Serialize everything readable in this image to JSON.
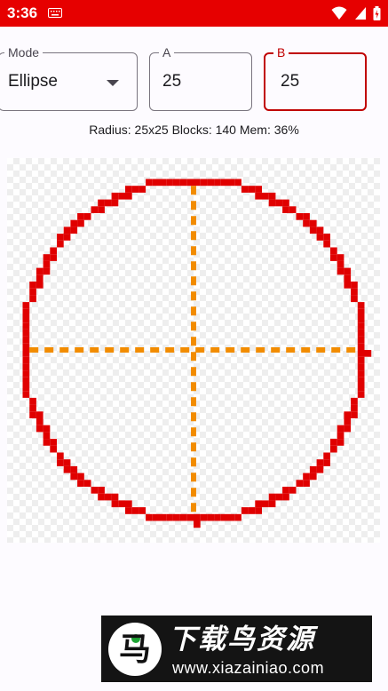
{
  "status": {
    "time": "3:36",
    "icons": [
      "keyboard-icon",
      "wifi-icon",
      "signal-icon",
      "battery-icon"
    ]
  },
  "controls": {
    "mode": {
      "label": "Mode",
      "value": "Ellipse"
    },
    "a": {
      "label": "A",
      "value": "25"
    },
    "b": {
      "label": "B",
      "value": "25"
    }
  },
  "info": "Radius: 25x25 Blocks: 140 Mem: 36%",
  "canvas": {
    "shape": "ellipse",
    "radius_a": 25,
    "radius_b": 25,
    "outline_color": "#e00000",
    "axis_color": "#f28c00",
    "checker_color": "#eeeeee"
  },
  "ad": {
    "logo_glyph": "马",
    "title": "下载鸟资源",
    "url": "www.xiazainiao.com"
  },
  "colors": {
    "accent": "#e60000",
    "focus": "#c00000"
  }
}
